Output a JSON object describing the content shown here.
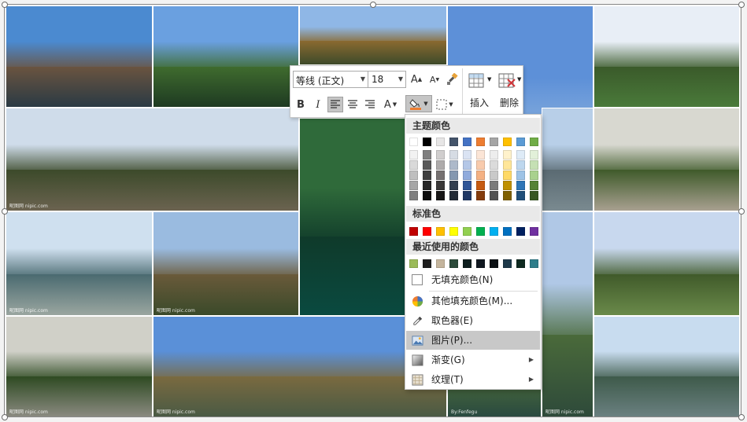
{
  "toolbar": {
    "font_name": "等线 (正文)",
    "font_size": "18",
    "insert_label": "插入",
    "delete_label": "删除",
    "bold": "B",
    "italic": "I",
    "font_color_letter": "A",
    "grow_letter": "A",
    "shrink_letter": "A"
  },
  "menu": {
    "theme_colors_header": "主题颜色",
    "standard_colors_header": "标准色",
    "recent_colors_header": "最近使用的颜色",
    "no_fill": "无填充颜色(N)",
    "more_fill": "其他填充颜色(M)...",
    "eyedropper": "取色器(E)",
    "picture": "图片(P)...",
    "gradient": "渐变(G)",
    "texture": "纹理(T)",
    "theme_columns": [
      [
        "#ffffff",
        "#f2f2f2",
        "#d9d9d9",
        "#bfbfbf",
        "#a6a6a6",
        "#7f7f7f"
      ],
      [
        "#000000",
        "#7f7f7f",
        "#595959",
        "#3f3f3f",
        "#262626",
        "#0d0d0d"
      ],
      [
        "#e7e6e6",
        "#d0cece",
        "#aeabab",
        "#757070",
        "#3a3838",
        "#171616"
      ],
      [
        "#44546a",
        "#d6dce4",
        "#adb9ca",
        "#8497b0",
        "#333f4f",
        "#222a35"
      ],
      [
        "#4472c4",
        "#dae3f3",
        "#b4c7e7",
        "#8faadc",
        "#2f5597",
        "#1f3864"
      ],
      [
        "#ed7d31",
        "#fbe5d6",
        "#f8cbad",
        "#f4b183",
        "#c55a11",
        "#843c0c"
      ],
      [
        "#a5a5a5",
        "#ededed",
        "#dbdbdb",
        "#c9c9c9",
        "#7b7b7b",
        "#525252"
      ],
      [
        "#ffc000",
        "#fff2cc",
        "#ffe699",
        "#ffd966",
        "#bf9000",
        "#7f6000"
      ],
      [
        "#5b9bd5",
        "#deebf7",
        "#bdd7ee",
        "#9dc3e6",
        "#2e75b6",
        "#1f4e79"
      ],
      [
        "#70ad47",
        "#e2f0d9",
        "#c5e0b4",
        "#a9d18e",
        "#548235",
        "#385723"
      ]
    ],
    "standard_colors": [
      "#c00000",
      "#ff0000",
      "#ffc000",
      "#ffff00",
      "#92d050",
      "#00b050",
      "#00b0f0",
      "#0070c0",
      "#002060",
      "#7030a0"
    ],
    "recent_colors": [
      "#9bbb59",
      "#1f1f1f",
      "#c4b59d",
      "#2b4a3a",
      "#0e1e1e",
      "#101820",
      "#0c1014",
      "#1e3a4a",
      "#0f2a20",
      "#2e7d8a"
    ]
  },
  "photos": [
    {
      "name": "photo-pavilion-lake-1",
      "sky": "#4b8ad0",
      "mid": "#6a5440",
      "low": "#2a3a44",
      "wm": ""
    },
    {
      "name": "photo-park-pond",
      "sky": "#6aa0e0",
      "mid": "#3f6b2e",
      "low": "#1e3a22",
      "wm": ""
    },
    {
      "name": "photo-tree-pavilion",
      "sky": "#8fb7e6",
      "mid": "#8a6a30",
      "low": "#3d4a2a",
      "wm": ""
    },
    {
      "name": "photo-willow-sky",
      "sky": "#5d90d8",
      "mid": "#8ab0dd",
      "low": "#c8d8ea",
      "wm": ""
    },
    {
      "name": "photo-lotus-bridge",
      "sky": "#e8eef6",
      "mid": "#3a5a2a",
      "low": "#4a7a3a",
      "wm": ""
    },
    {
      "name": "photo-tree-road",
      "sky": "#cfdcea",
      "mid": "#3c4a2a",
      "low": "#6b6350",
      "wm": "昵图网 nipic.com"
    },
    {
      "name": "photo-green-pond",
      "sky": "#2f6a3a",
      "mid": "#0f3a2a",
      "low": "#0a4a40",
      "wm": ""
    },
    {
      "name": "photo-winter-trees",
      "sky": "#b8cfe8",
      "mid": "#5a6a72",
      "low": "#7a8a90",
      "wm": ""
    },
    {
      "name": "photo-moon-gate-1",
      "sky": "#d8d8d0",
      "mid": "#3f5a2a",
      "low": "#a8a090",
      "wm": ""
    },
    {
      "name": "photo-five-pavilion-bridge",
      "sky": "#cfe0ef",
      "mid": "#4a6a70",
      "low": "#9aa6a0",
      "wm": "昵图网 nipic.com"
    },
    {
      "name": "photo-rock-garden",
      "sky": "#9abbe0",
      "mid": "#6a5a3a",
      "low": "#3a4a2a",
      "wm": "昵图网 nipic.com"
    },
    {
      "name": "photo-lake-willow",
      "sky": "#b0c8e6",
      "mid": "#4a6a3a",
      "low": "#2e4a3a",
      "wm": "昵图网 nipic.com"
    },
    {
      "name": "photo-willow-tower",
      "sky": "#c8d8ee",
      "mid": "#405a2a",
      "low": "#6a8a4a",
      "wm": ""
    },
    {
      "name": "photo-moon-gate-2",
      "sky": "#d0d0c8",
      "mid": "#2e4a22",
      "low": "#8a8a80",
      "wm": "昵图网 nipic.com"
    },
    {
      "name": "photo-pavilion-lake-2",
      "sky": "#5a90d8",
      "mid": "#7a6a40",
      "low": "#4a5a44",
      "wm": "昵图网 nipic.com"
    },
    {
      "name": "photo-red-pavilion",
      "sky": "#8ab0d8",
      "mid": "#4a6a3a",
      "low": "#2a4a40",
      "wm": "By:Fenfegu"
    },
    {
      "name": "photo-five-pavilion-2",
      "sky": "#c8dcef",
      "mid": "#3e5a4a",
      "low": "#6a8080",
      "wm": ""
    }
  ]
}
